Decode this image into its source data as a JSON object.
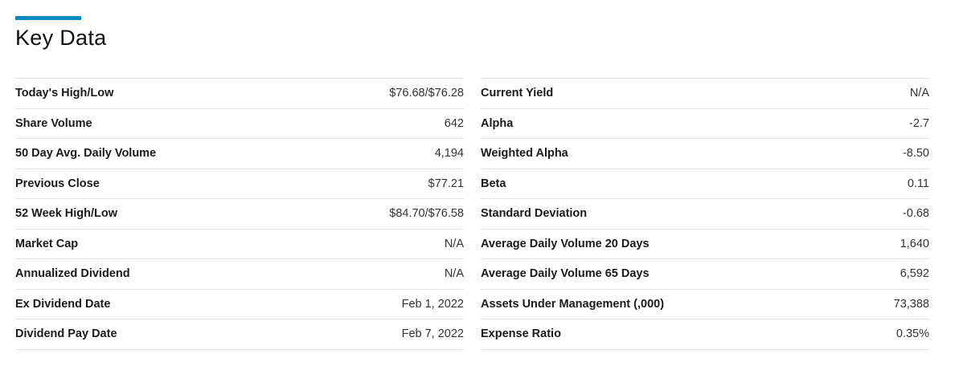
{
  "section": {
    "title": "Key Data",
    "accent_color": "#0a8ac4"
  },
  "left_table": [
    {
      "label": "Today's High/Low",
      "value": "$76.68/$76.28"
    },
    {
      "label": "Share Volume",
      "value": "642"
    },
    {
      "label": "50 Day Avg. Daily Volume",
      "value": "4,194"
    },
    {
      "label": "Previous Close",
      "value": "$77.21"
    },
    {
      "label": "52 Week High/Low",
      "value": "$84.70/$76.58"
    },
    {
      "label": "Market Cap",
      "value": "N/A"
    },
    {
      "label": "Annualized Dividend",
      "value": "N/A"
    },
    {
      "label": "Ex Dividend Date",
      "value": "Feb 1, 2022"
    },
    {
      "label": "Dividend Pay Date",
      "value": "Feb 7, 2022"
    }
  ],
  "right_table": [
    {
      "label": "Current Yield",
      "value": "N/A"
    },
    {
      "label": "Alpha",
      "value": "-2.7"
    },
    {
      "label": "Weighted Alpha",
      "value": "-8.50"
    },
    {
      "label": "Beta",
      "value": "0.11"
    },
    {
      "label": "Standard Deviation",
      "value": "-0.68"
    },
    {
      "label": "Average Daily Volume 20 Days",
      "value": "1,640"
    },
    {
      "label": "Average Daily Volume 65 Days",
      "value": "6,592"
    },
    {
      "label": "Assets Under Management (,000)",
      "value": "73,388"
    },
    {
      "label": "Expense Ratio",
      "value": "0.35%"
    }
  ]
}
